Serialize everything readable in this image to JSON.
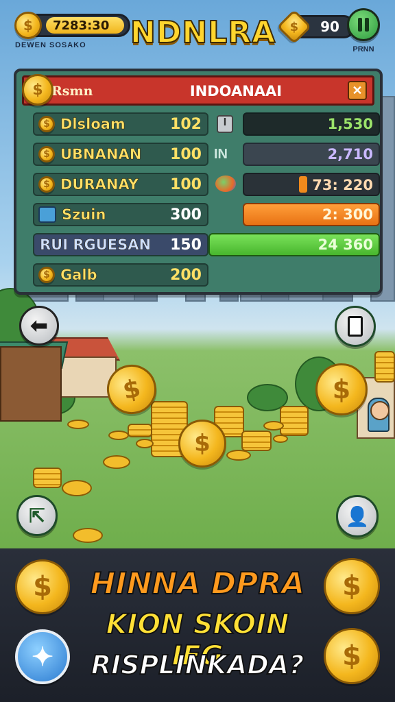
{
  "header": {
    "coins_value": "7283:30",
    "coins_caption": "DEWEN SOSAKO",
    "title": "NDNLRA",
    "gems_value": "90",
    "settings_caption": "PRNN",
    "settings_icon": "pause-icon"
  },
  "panel": {
    "tab_label": "Rsmn",
    "title": "INDOANAAI",
    "close_icon": "close-icon",
    "rows": [
      {
        "name": "Dlsloam",
        "value": "102",
        "icon": "coin-icon"
      },
      {
        "name": "UBNANAN",
        "value": "100",
        "icon": "coin-icon"
      },
      {
        "name": "DURANAY",
        "value": "100",
        "icon": "coin-icon"
      },
      {
        "name": "Szuin",
        "value": "300",
        "icon": "chest-icon"
      },
      {
        "name": "RUI RGUESAN",
        "value": "150",
        "icon": ""
      },
      {
        "name": "Galb",
        "value": "200",
        "icon": "coin-icon"
      }
    ],
    "right_rows": [
      {
        "label": "I",
        "value": "1,530",
        "color": "#1e2a2a",
        "text": "#9be26a"
      },
      {
        "label": "IN",
        "value": "2,710",
        "color": "#3b4650",
        "text": "#c9b8ff"
      },
      {
        "label": "",
        "value": "73: 220",
        "color": "#2a3238",
        "text": "#ffd9b0"
      },
      {
        "label": "",
        "value": "2: 300",
        "color": "#f08a1c",
        "text": "#fff6d8"
      },
      {
        "label": "",
        "value": "24 360",
        "color": "#5cc93e",
        "text": "#eaffd8"
      }
    ]
  },
  "controls": {
    "back_icon": "arrow-left-icon",
    "card_icon": "card-icon",
    "exit_icon": "exit-icon",
    "profile_icon": "profile-icon",
    "share_icon": "share-icon"
  },
  "banner": {
    "line1": "HINNA DPRA",
    "line2": "KION SKOIN IFG",
    "line3": "RISPLINKADA?"
  }
}
